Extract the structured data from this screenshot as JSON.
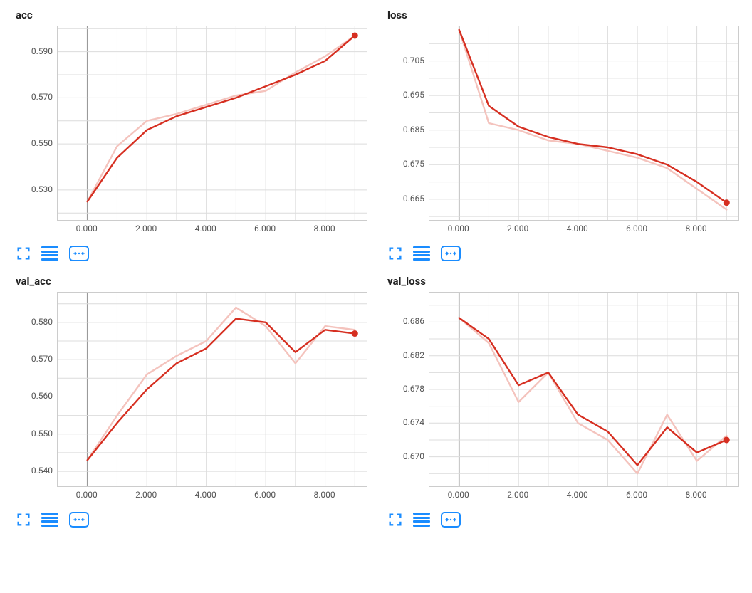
{
  "colors": {
    "line": "#d62f21",
    "lineFaint": "#f4c3bd",
    "marker": "#d62f21",
    "grid": "#dcdcdc",
    "zeroLine": "#9a9a9a",
    "icon": "#1a8cff",
    "border": "#cccccc"
  },
  "xTickFormat": "fixed3",
  "panels": [
    {
      "id": "acc",
      "title": "acc"
    },
    {
      "id": "loss",
      "title": "loss"
    },
    {
      "id": "val_acc",
      "title": "val_acc"
    },
    {
      "id": "val_loss",
      "title": "val_loss"
    }
  ],
  "chart_data": [
    {
      "id": "acc",
      "type": "line",
      "title": "acc",
      "xlabel": "",
      "ylabel": "",
      "xlim": [
        -1.0,
        9.4
      ],
      "ylim": [
        0.517,
        0.601
      ],
      "x_ticks": [
        0,
        2,
        4,
        6,
        8
      ],
      "y_ticks": [
        0.53,
        0.55,
        0.57,
        0.59
      ],
      "x": [
        0,
        1,
        2,
        3,
        4,
        5,
        6,
        7,
        8,
        9
      ],
      "series": [
        {
          "name": "smoothed",
          "values": [
            0.525,
            0.544,
            0.556,
            0.562,
            0.566,
            0.57,
            0.575,
            0.58,
            0.586,
            0.597
          ],
          "style": "main"
        },
        {
          "name": "raw",
          "values": [
            0.525,
            0.549,
            0.56,
            0.563,
            0.567,
            0.571,
            0.573,
            0.581,
            0.588,
            0.597
          ],
          "style": "faint"
        }
      ],
      "marker_at_end": true
    },
    {
      "id": "loss",
      "type": "line",
      "title": "loss",
      "xlabel": "",
      "ylabel": "",
      "xlim": [
        -1.0,
        9.4
      ],
      "ylim": [
        0.659,
        0.715
      ],
      "x_ticks": [
        0,
        2,
        4,
        6,
        8
      ],
      "y_ticks": [
        0.665,
        0.675,
        0.685,
        0.695,
        0.705
      ],
      "x": [
        0,
        1,
        2,
        3,
        4,
        5,
        6,
        7,
        8,
        9
      ],
      "series": [
        {
          "name": "smoothed",
          "values": [
            0.714,
            0.692,
            0.686,
            0.683,
            0.681,
            0.68,
            0.678,
            0.675,
            0.67,
            0.664
          ],
          "style": "main"
        },
        {
          "name": "raw",
          "values": [
            0.714,
            0.687,
            0.685,
            0.682,
            0.681,
            0.679,
            0.677,
            0.674,
            0.668,
            0.662
          ],
          "style": "faint"
        }
      ],
      "marker_at_end": true
    },
    {
      "id": "val_acc",
      "type": "line",
      "title": "val_acc",
      "xlabel": "",
      "ylabel": "",
      "xlim": [
        -1.0,
        9.4
      ],
      "ylim": [
        0.536,
        0.588
      ],
      "x_ticks": [
        0,
        2,
        4,
        6,
        8
      ],
      "y_ticks": [
        0.54,
        0.55,
        0.56,
        0.57,
        0.58
      ],
      "x": [
        0,
        1,
        2,
        3,
        4,
        5,
        6,
        7,
        8,
        9
      ],
      "series": [
        {
          "name": "smoothed",
          "values": [
            0.543,
            0.553,
            0.562,
            0.569,
            0.573,
            0.581,
            0.58,
            0.572,
            0.578,
            0.577
          ],
          "style": "main"
        },
        {
          "name": "raw",
          "values": [
            0.543,
            0.555,
            0.566,
            0.571,
            0.575,
            0.584,
            0.579,
            0.569,
            0.579,
            0.578
          ],
          "style": "faint"
        }
      ],
      "marker_at_end": true
    },
    {
      "id": "val_loss",
      "type": "line",
      "title": "val_loss",
      "xlabel": "",
      "ylabel": "",
      "xlim": [
        -1.0,
        9.4
      ],
      "ylim": [
        0.6665,
        0.6895
      ],
      "x_ticks": [
        0,
        2,
        4,
        6,
        8
      ],
      "y_ticks": [
        0.67,
        0.674,
        0.678,
        0.682,
        0.686
      ],
      "x": [
        0,
        1,
        2,
        3,
        4,
        5,
        6,
        7,
        8,
        9
      ],
      "series": [
        {
          "name": "smoothed",
          "values": [
            0.6865,
            0.684,
            0.6785,
            0.68,
            0.675,
            0.673,
            0.669,
            0.6735,
            0.6705,
            0.672
          ],
          "style": "main"
        },
        {
          "name": "raw",
          "values": [
            0.6865,
            0.6835,
            0.6765,
            0.68,
            0.674,
            0.672,
            0.668,
            0.675,
            0.6695,
            0.6725
          ],
          "style": "faint"
        }
      ],
      "marker_at_end": true
    }
  ]
}
